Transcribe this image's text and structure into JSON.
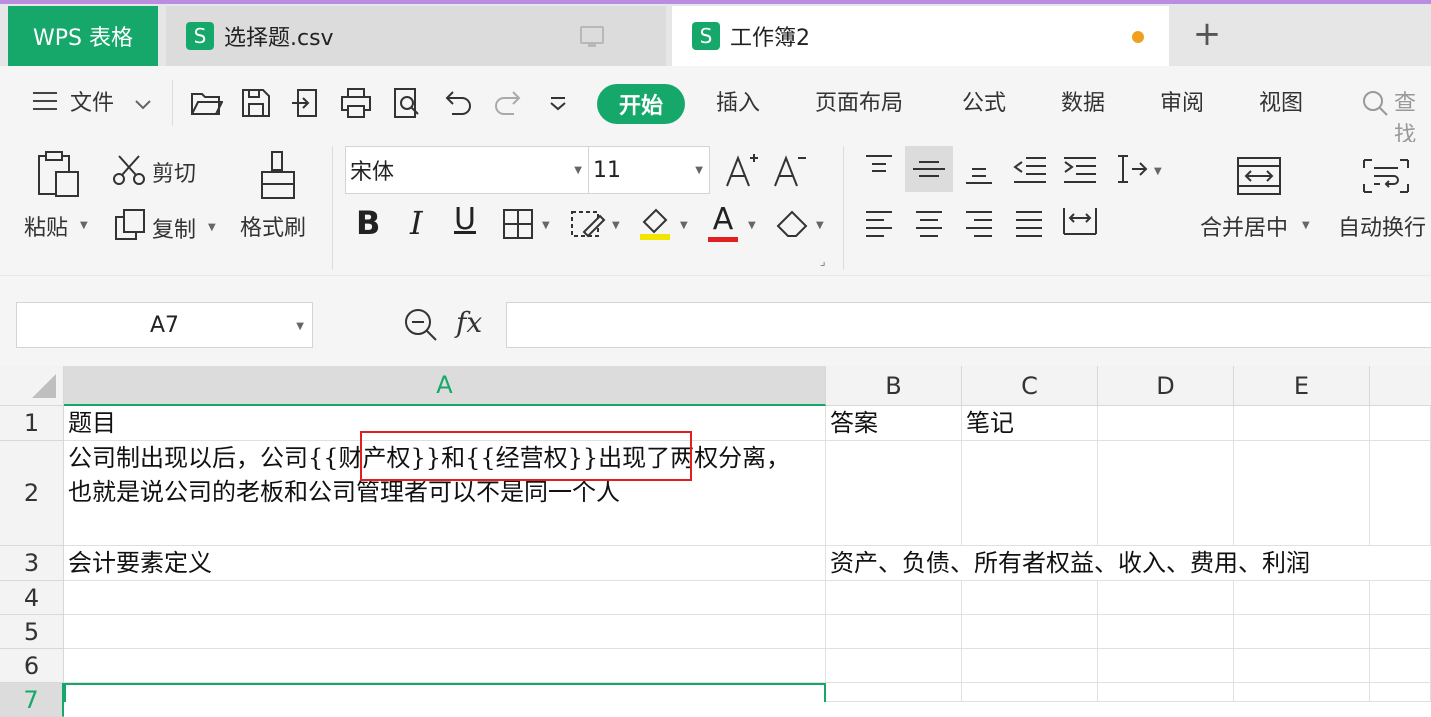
{
  "tabs": {
    "app": "WPS 表格",
    "doc1": "选择题.csv",
    "doc2": "工作簿2",
    "new_tab": "+",
    "icon_letter": "S",
    "modified_dot_color": "#f0a020"
  },
  "menu": {
    "file": "文件",
    "items": [
      "开始",
      "插入",
      "页面布局",
      "公式",
      "数据",
      "审阅",
      "视图"
    ],
    "search": "查找"
  },
  "ribbon": {
    "paste": "粘贴",
    "cut": "剪切",
    "copy": "复制",
    "format_painter": "格式刷",
    "font_name": "宋体",
    "font_size": "11",
    "merge_center": "合并居中",
    "wrap_text": "自动换行",
    "bold": "B",
    "italic": "I",
    "underline": "U",
    "font_color": "A"
  },
  "formula_bar": {
    "name_box": "A7",
    "fx": "fx",
    "value": ""
  },
  "columns": [
    "A",
    "B",
    "C",
    "D",
    "E"
  ],
  "rows": [
    "1",
    "2",
    "3",
    "4",
    "5",
    "6",
    "7"
  ],
  "cells": {
    "A1": "题目",
    "B1": "答案",
    "C1": "笔记",
    "A2": "公司制出现以后，公司{{财产权}}和{{经营权}}出现了两权分离，也就是说公司的老板和公司管理者可以不是同一个人",
    "A3": "会计要素定义",
    "B3": "资产、负债、所有者权益、收入、费用、利润"
  },
  "colors": {
    "accent": "#16a86b",
    "highlight_box": "#e02020"
  }
}
